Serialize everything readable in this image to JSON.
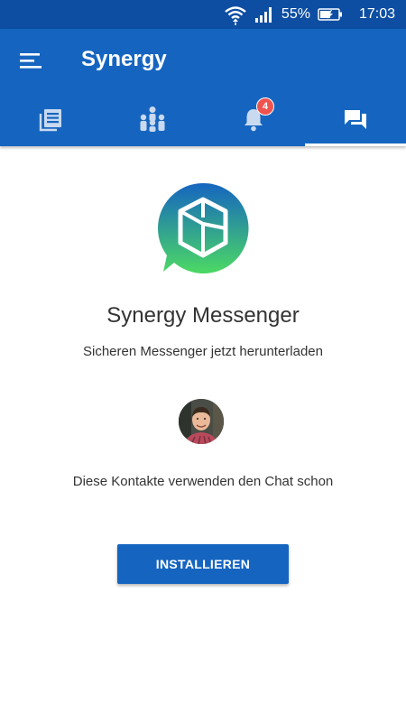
{
  "status_bar": {
    "battery": "55%",
    "time": "17:03",
    "icons": [
      "wifi-icon",
      "signal-icon",
      "battery-charging-icon"
    ]
  },
  "app_bar": {
    "title": "Synergy",
    "menu_icon": "hamburger-menu-icon"
  },
  "tabs": [
    {
      "icon": "news-feed-icon",
      "active": false
    },
    {
      "icon": "people-group-icon",
      "active": false
    },
    {
      "icon": "notifications-bell-icon",
      "active": false,
      "badge": "4"
    },
    {
      "icon": "chat-icon",
      "active": true
    }
  ],
  "main": {
    "logo_icon": "synergy-messenger-logo-icon",
    "title": "Synergy Messenger",
    "subtitle": "Sicheren Messenger jetzt herunterladen",
    "contacts_text": "Diese Kontakte verwenden den Chat schon",
    "install_label": "INSTALLIEREN"
  },
  "colors": {
    "status_bar": "#0d4ea3",
    "app_bar": "#1565c0",
    "badge": "#ef5350",
    "button": "#1565c0",
    "logo_gradient_start": "#1565c0",
    "logo_gradient_end": "#4cd964"
  }
}
